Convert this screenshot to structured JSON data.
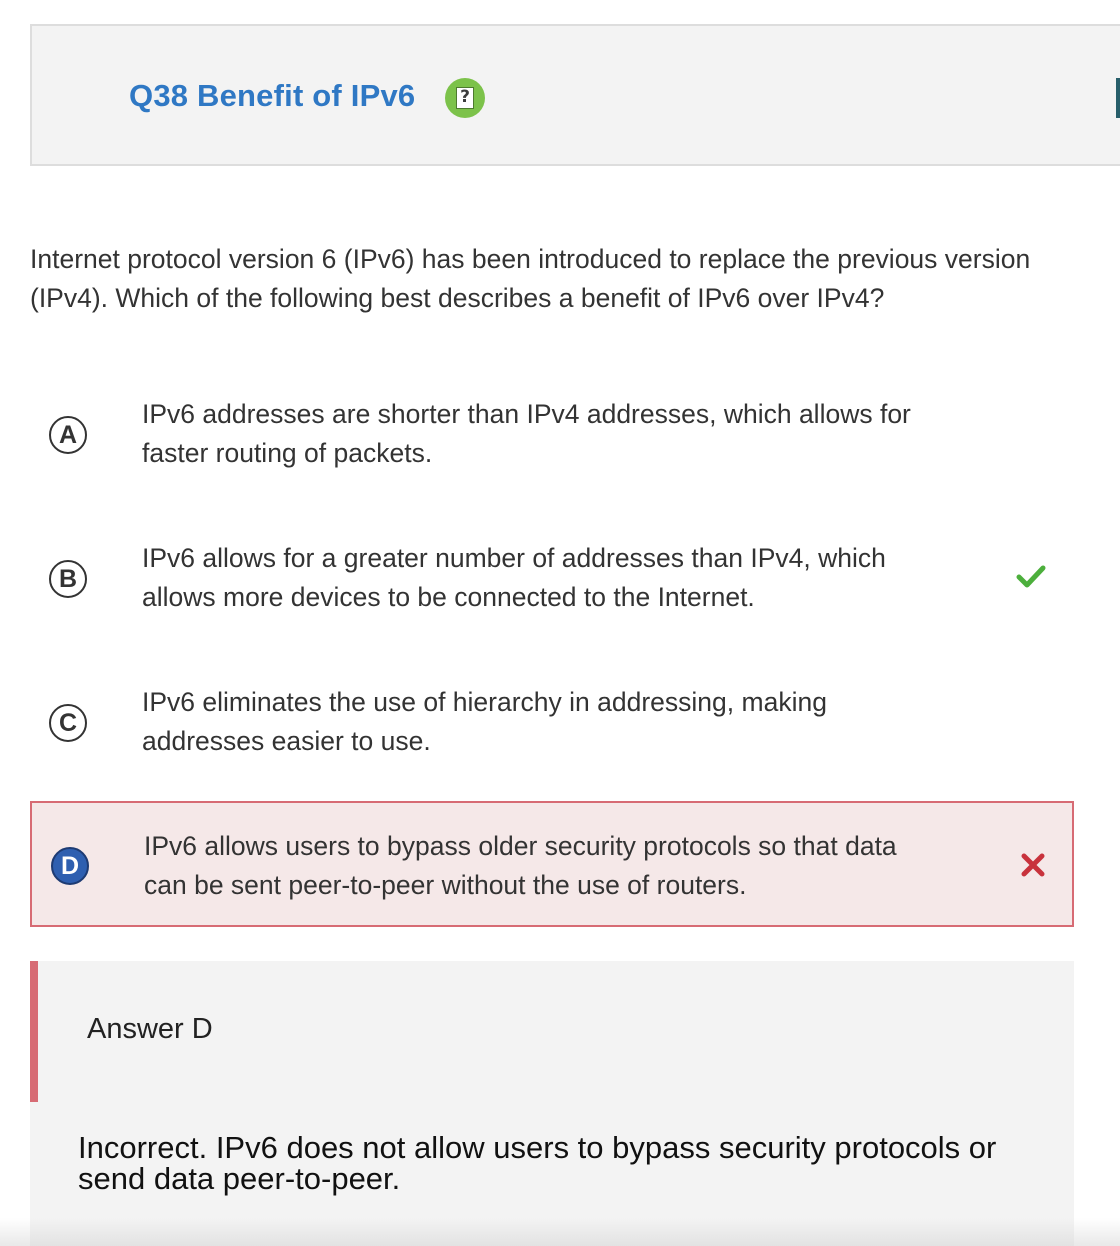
{
  "header": {
    "title": "Q38 Benefit of IPv6",
    "help_icon": "question-help-icon",
    "help_glyph": "?"
  },
  "question": {
    "text": "Internet protocol version 6 (IPv6) has been introduced to replace the previous version (IPv4). Which of the following best describes a benefit of IPv6 over IPv4?"
  },
  "options": [
    {
      "letter": "A",
      "text": "IPv6 addresses are shorter than IPv4 addresses, which allows for faster routing of packets.",
      "status": "none"
    },
    {
      "letter": "B",
      "text": "IPv6 allows for a greater number of addresses than IPv4, which allows more devices to be connected to the Internet.",
      "status": "correct",
      "status_icon": "checkmark-icon"
    },
    {
      "letter": "C",
      "text": "IPv6 eliminates the use of hierarchy in addressing, making addresses easier to use.",
      "status": "none"
    },
    {
      "letter": "D",
      "text": "IPv6 allows users to bypass older security protocols so that data can be sent peer-to-peer without the use of routers.",
      "status": "selected-incorrect",
      "status_icon": "cross-icon"
    }
  ],
  "answer": {
    "label": "Answer D",
    "explanation": "Incorrect. IPv6 does not allow users to bypass security protocols or send data peer-to-peer."
  },
  "colors": {
    "title_blue": "#2f78c4",
    "help_green": "#7cc24a",
    "accent_teal": "#275e6a",
    "correct_green": "#4caf3c",
    "incorrect_red": "#c8323c",
    "incorrect_border": "#d76b74",
    "incorrect_bg": "#f5e8e8",
    "selected_blue": "#2e5fb0"
  }
}
